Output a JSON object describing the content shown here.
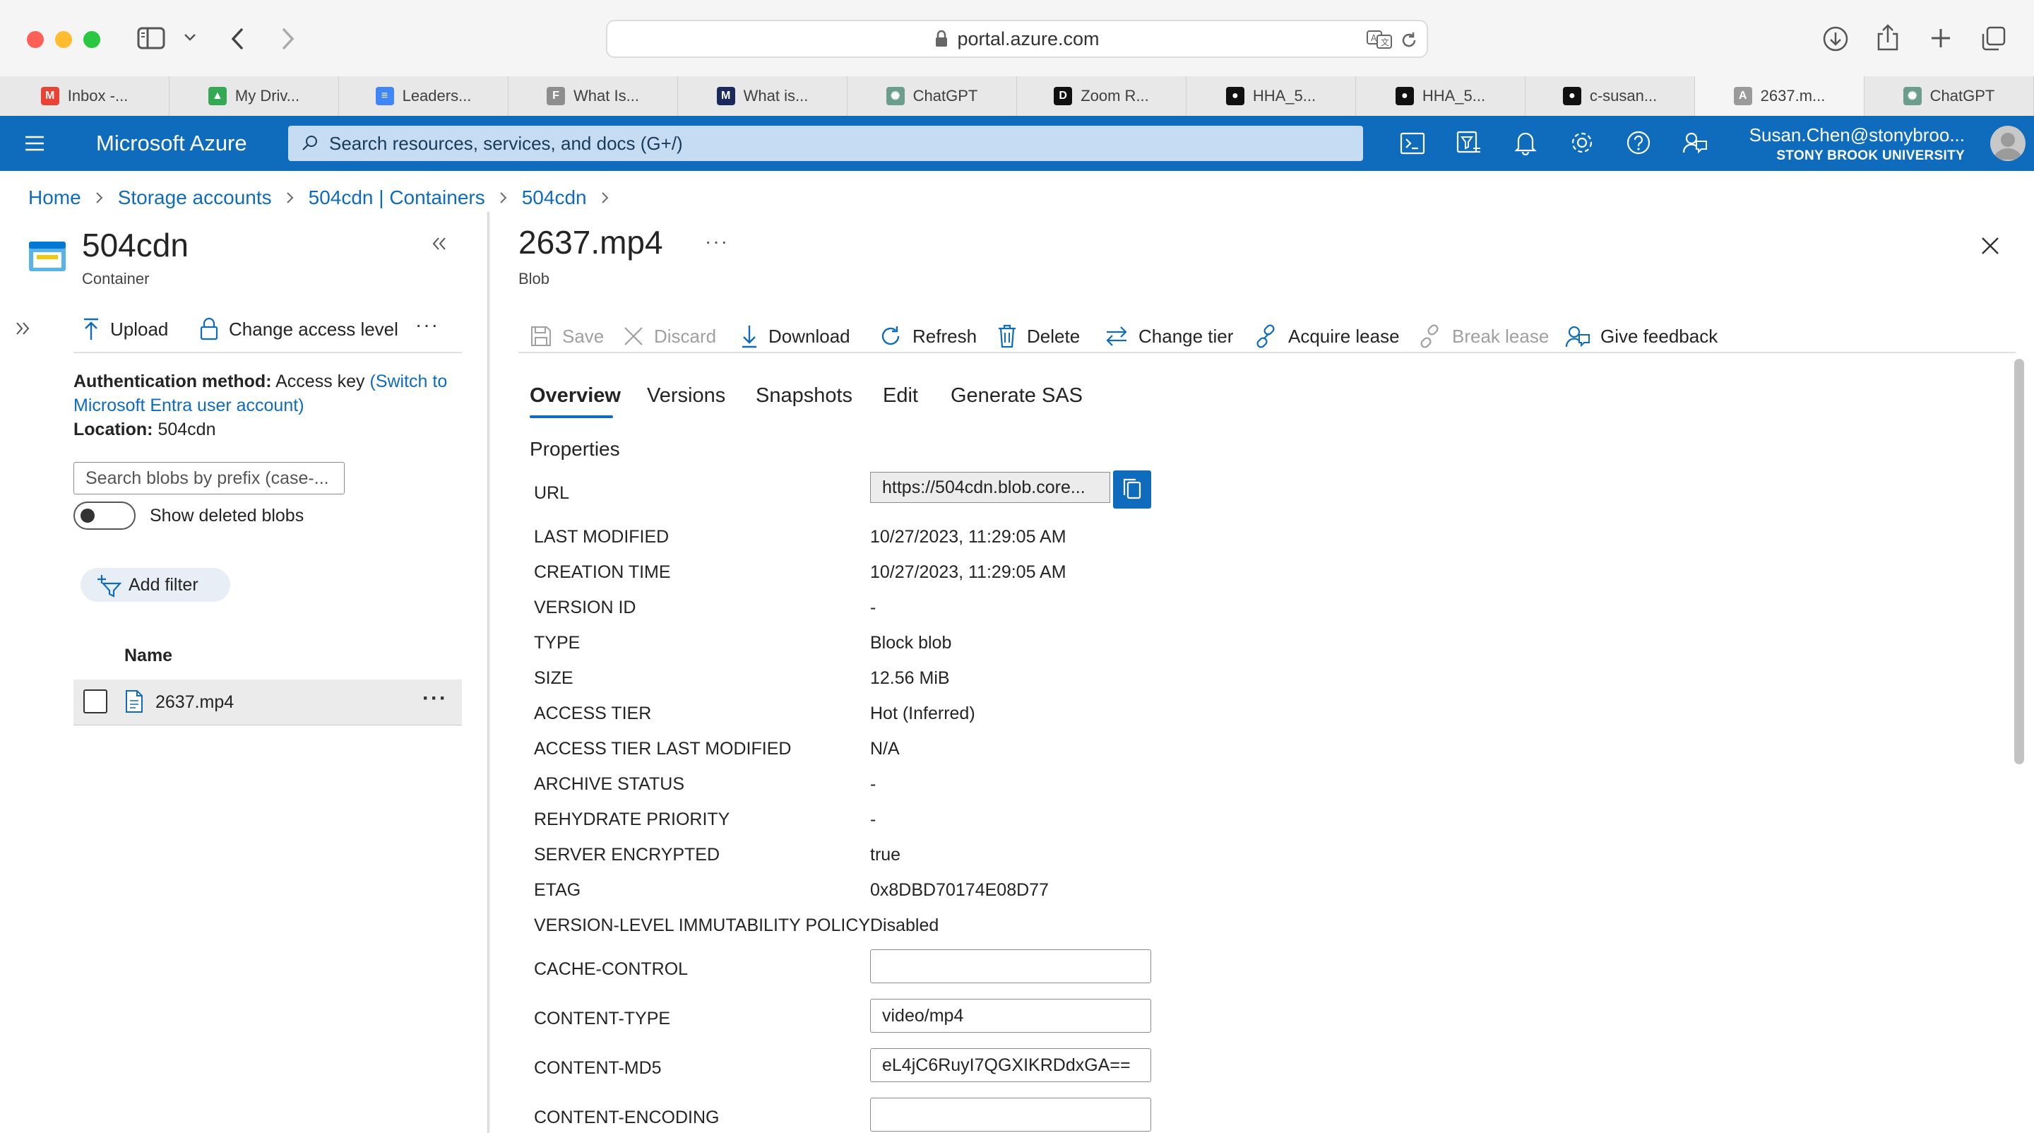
{
  "browser": {
    "url": "portal.azure.com",
    "tabs": [
      {
        "label": "Inbox -...",
        "icon": "gmail-icon",
        "color": "#ea4335",
        "glyph": "M"
      },
      {
        "label": "My Driv...",
        "icon": "google-drive-icon",
        "color": "#34a853",
        "glyph": "▲"
      },
      {
        "label": "Leaders...",
        "icon": "google-docs-icon",
        "color": "#4285f4",
        "glyph": "≡"
      },
      {
        "label": "What Is...",
        "icon": "f-site-icon",
        "color": "#8e8e8e",
        "glyph": "F"
      },
      {
        "label": "What is...",
        "icon": "m-site-icon",
        "color": "#1b2a5c",
        "glyph": "M"
      },
      {
        "label": "ChatGPT",
        "icon": "chatgpt-icon",
        "color": "#6b9e8c",
        "glyph": "✺"
      },
      {
        "label": "Zoom R...",
        "icon": "d2l-icon",
        "color": "#111111",
        "glyph": "D"
      },
      {
        "label": "HHA_5...",
        "icon": "github-icon",
        "color": "#111111",
        "glyph": "●"
      },
      {
        "label": "HHA_5...",
        "icon": "github-icon",
        "color": "#111111",
        "glyph": "●"
      },
      {
        "label": "c-susan...",
        "icon": "github-icon",
        "color": "#111111",
        "glyph": "●"
      },
      {
        "label": "2637.m...",
        "icon": "azure-a-icon",
        "color": "#9a9a9a",
        "glyph": "A"
      },
      {
        "label": "ChatGPT",
        "icon": "chatgpt-icon",
        "color": "#6b9e8c",
        "glyph": "✺"
      }
    ],
    "active_tab": 10
  },
  "topbar": {
    "brand": "Microsoft Azure",
    "search_placeholder": "Search resources, services, and docs (G+/)",
    "user_name": "Susan.Chen@stonybroo...",
    "user_org": "STONY BROOK UNIVERSITY",
    "color": "#0f6cbd"
  },
  "breadcrumb": [
    "Home",
    "Storage accounts",
    "504cdn | Containers",
    "504cdn"
  ],
  "container": {
    "title": "504cdn",
    "subtitle": "Container",
    "toolbar": {
      "upload": "Upload",
      "change_access": "Change access level",
      "more": "···"
    },
    "auth_label": "Authentication method:",
    "auth_value": "Access key",
    "auth_link_1": "(Switch to",
    "auth_link_2": "Microsoft Entra user account)",
    "location_label": "Location:",
    "location_value": "504cdn",
    "search_placeholder": "Search blobs by prefix (case-...",
    "show_deleted": "Show deleted blobs",
    "add_filter": "Add filter",
    "column_name": "Name",
    "blobs": [
      {
        "name": "2637.mp4",
        "more": "···"
      }
    ]
  },
  "blob": {
    "title": "2637.mp4",
    "more": "···",
    "subtitle": "Blob",
    "toolbar": {
      "save": "Save",
      "discard": "Discard",
      "download": "Download",
      "refresh": "Refresh",
      "delete": "Delete",
      "change_tier": "Change tier",
      "acquire_lease": "Acquire lease",
      "break_lease": "Break lease",
      "give_feedback": "Give feedback"
    },
    "tabs": [
      "Overview",
      "Versions",
      "Snapshots",
      "Edit",
      "Generate SAS"
    ],
    "active_tab": 0,
    "section": "Properties",
    "url_label": "URL",
    "url_value": "https://504cdn.blob.core...",
    "properties": [
      {
        "label": "LAST MODIFIED",
        "value": "10/27/2023, 11:29:05 AM"
      },
      {
        "label": "CREATION TIME",
        "value": "10/27/2023, 11:29:05 AM"
      },
      {
        "label": "VERSION ID",
        "value": "-"
      },
      {
        "label": "TYPE",
        "value": "Block blob"
      },
      {
        "label": "SIZE",
        "value": "12.56 MiB"
      },
      {
        "label": "ACCESS TIER",
        "value": "Hot (Inferred)"
      },
      {
        "label": "ACCESS TIER LAST MODIFIED",
        "value": "N/A"
      },
      {
        "label": "ARCHIVE STATUS",
        "value": "-"
      },
      {
        "label": "REHYDRATE PRIORITY",
        "value": "-"
      },
      {
        "label": "SERVER ENCRYPTED",
        "value": "true"
      },
      {
        "label": "ETAG",
        "value": "0x8DBD70174E08D77"
      },
      {
        "label": "VERSION-LEVEL IMMUTABILITY POLICY",
        "value": "Disabled"
      }
    ],
    "editable": [
      {
        "label": "CACHE-CONTROL",
        "value": ""
      },
      {
        "label": "CONTENT-TYPE",
        "value": "video/mp4"
      },
      {
        "label": "CONTENT-MD5",
        "value": "eL4jC6RuyI7QGXIKRDdxGA=="
      },
      {
        "label": "CONTENT-ENCODING",
        "value": ""
      }
    ]
  }
}
